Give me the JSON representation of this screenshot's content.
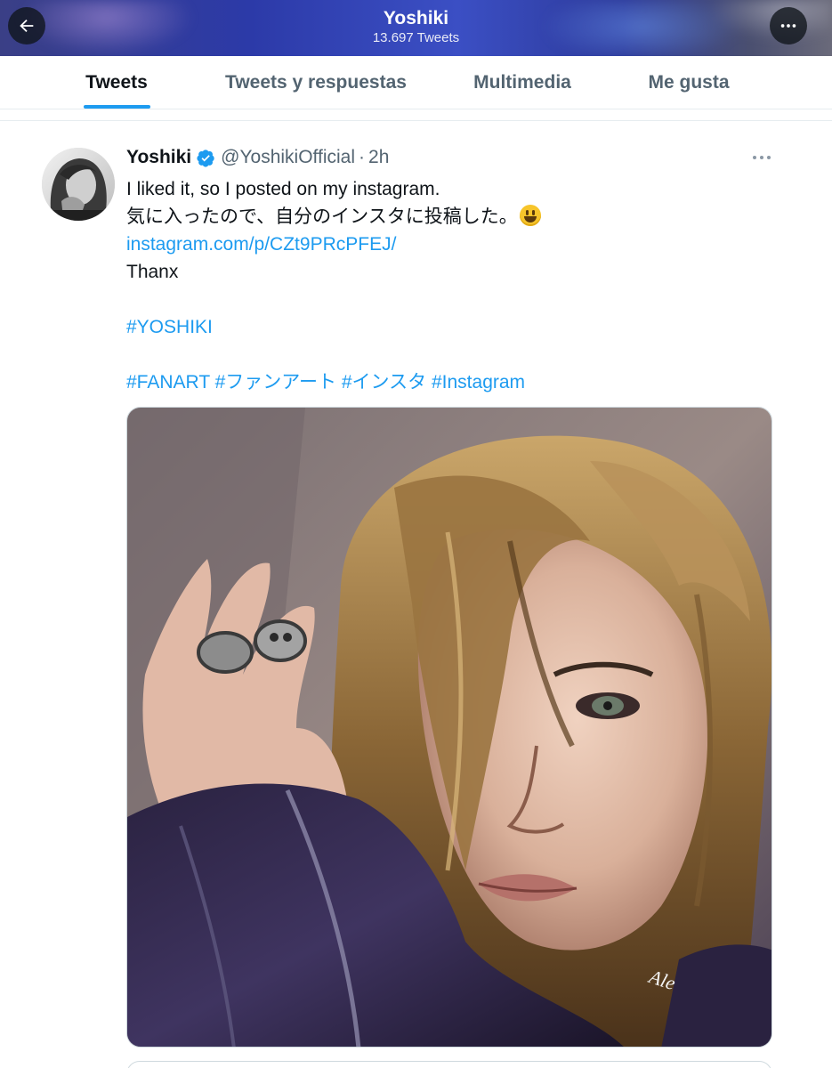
{
  "header": {
    "title": "Yoshiki",
    "subtitle": "13.697 Tweets",
    "back_icon": "arrow-left-icon",
    "more_icon": "more-horizontal-icon"
  },
  "tabs": [
    {
      "label": "Tweets",
      "active": true
    },
    {
      "label": "Tweets y respuestas",
      "active": false
    },
    {
      "label": "Multimedia",
      "active": false
    },
    {
      "label": "Me gusta",
      "active": false
    }
  ],
  "tweet": {
    "author_name": "Yoshiki",
    "verified": true,
    "handle": "@YoshikiOfficial",
    "separator": "·",
    "time": "2h",
    "line1": "I liked it, so I posted on my instagram.",
    "line2": "気に入ったので、自分のインスタに投稿した。",
    "emoji": "grinning-face-emoji",
    "link": "instagram.com/p/CZt9PRcPFEJ/",
    "line3": "Thanx",
    "hashtag1": "#YOSHIKI",
    "hashtags": [
      "#FANART",
      "#ファンアート",
      "#インスタ",
      "#Instagram"
    ],
    "media_signature": "Ale"
  },
  "colors": {
    "accent": "#1d9bf0",
    "text_primary": "#0f1419",
    "text_secondary": "#536471",
    "divider": "#e6ecf0"
  }
}
